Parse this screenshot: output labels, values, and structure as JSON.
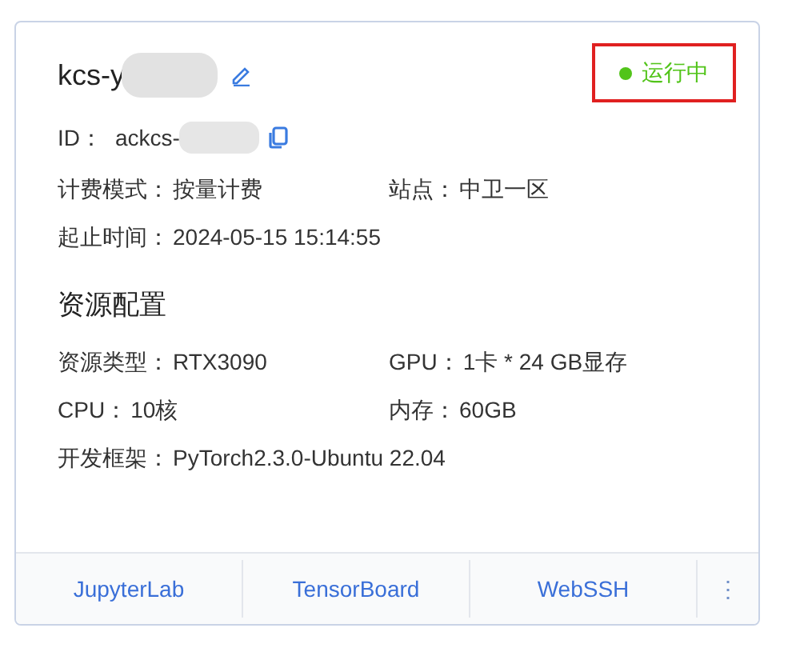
{
  "card": {
    "title": "kcs-y",
    "status": {
      "label": "运行中",
      "color": "#52c41a"
    },
    "id": {
      "label": "ID：",
      "value": "ackcs-"
    },
    "info_rows": [
      [
        {
          "label": "计费模式：",
          "value": "按量计费"
        },
        {
          "label": "站点：",
          "value": "中卫一区"
        }
      ],
      [
        {
          "label": "起止时间：",
          "value": "2024-05-15 15:14:55"
        }
      ]
    ],
    "section_title": "资源配置",
    "resource_rows": [
      [
        {
          "label": "资源类型：",
          "value": "RTX3090"
        },
        {
          "label": "GPU：",
          "value": "1卡 * 24 GB显存"
        }
      ],
      [
        {
          "label": "CPU：",
          "value": "10核"
        },
        {
          "label": "内存：",
          "value": "60GB"
        }
      ],
      [
        {
          "label": "开发框架：",
          "value": "PyTorch2.3.0-Ubuntu 22.04"
        }
      ]
    ],
    "actions": [
      "JupyterLab",
      "TensorBoard",
      "WebSSH"
    ],
    "more": "⋮"
  }
}
